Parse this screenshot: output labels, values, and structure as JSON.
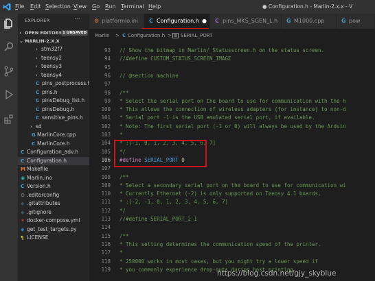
{
  "menubar": {
    "items": [
      {
        "label": "File"
      },
      {
        "label": "Edit"
      },
      {
        "label": "Selection"
      },
      {
        "label": "View"
      },
      {
        "label": "Go"
      },
      {
        "label": "Run"
      },
      {
        "label": "Terminal"
      },
      {
        "label": "Help"
      }
    ],
    "window_title": "● Configuration.h - Marlin-2.x.x - V"
  },
  "activitybar": {
    "icons": [
      "explorer-icon",
      "search-icon",
      "source-control-icon",
      "run-debug-icon",
      "extensions-icon"
    ]
  },
  "sidebar": {
    "title": "EXPLORER",
    "more": "···",
    "open_editors": {
      "label": "OPEN EDITORS",
      "badge": "1 UNSAVED"
    },
    "folder": {
      "label": "MARLIN-2.X.X"
    },
    "tree": [
      {
        "name": "stm32f7",
        "type": "folder"
      },
      {
        "name": "teensy2",
        "type": "folder"
      },
      {
        "name": "teensy3",
        "type": "folder"
      },
      {
        "name": "teensy4",
        "type": "folder"
      },
      {
        "name": "pins_postprocess.h",
        "type": "c"
      },
      {
        "name": "pins.h",
        "type": "c"
      },
      {
        "name": "pinsDebug_list.h",
        "type": "c"
      },
      {
        "name": "pinsDebug.h",
        "type": "c"
      },
      {
        "name": "sensitive_pins.h",
        "type": "c"
      },
      {
        "name": "sd",
        "type": "folder"
      },
      {
        "name": "MarlinCore.cpp",
        "type": "cpp"
      },
      {
        "name": "MarlinCore.h",
        "type": "c"
      },
      {
        "name": "Configuration_adv.h",
        "type": "c"
      },
      {
        "name": "Configuration.h",
        "type": "c"
      },
      {
        "name": "Makefile",
        "type": "make"
      },
      {
        "name": "Marlin.ino",
        "type": "ino"
      },
      {
        "name": "Version.h",
        "type": "c"
      },
      {
        "name": ".editorconfig",
        "type": "gear"
      },
      {
        "name": ".gitattributes",
        "type": "git"
      },
      {
        "name": ".gitignore",
        "type": "git"
      },
      {
        "name": "docker-compose.yml",
        "type": "docker"
      },
      {
        "name": "get_test_targets.py",
        "type": "py"
      },
      {
        "name": "LICENSE",
        "type": "license"
      }
    ]
  },
  "tabs": [
    {
      "label": "platformio.ini",
      "icon": "⚙"
    },
    {
      "label": "Configuration.h",
      "icon": "C"
    },
    {
      "label": "pins_MKS_SGEN_L.h",
      "icon": "C"
    },
    {
      "label": "M1000.cpp",
      "icon": "G"
    },
    {
      "label": "pow",
      "icon": "G"
    }
  ],
  "breadcrumb": {
    "items": [
      "Marlin",
      ">",
      "C",
      "Configuration.h",
      ">",
      "SERIAL_PORT"
    ]
  },
  "editor": {
    "current_line": 106,
    "lines": [
      {
        "n": "93",
        "text": "// Show the bitmap in Marlin/_Statusscreen.h on the status screen."
      },
      {
        "n": "94",
        "text": "//#define CUSTOM_STATUS_SCREEN_IMAGE"
      },
      {
        "n": "95",
        "text": ""
      },
      {
        "n": "96",
        "text": "// @section machine"
      },
      {
        "n": "97",
        "text": ""
      },
      {
        "n": "98",
        "text": "/**"
      },
      {
        "n": "99",
        "text": " * Select the serial port on the board to use for communication with the h"
      },
      {
        "n": "100",
        "text": " * This allows the connection of wireless adapters (for instance) to non-d"
      },
      {
        "n": "101",
        "text": " * Serial port -1 is the USB emulated serial port, if available."
      },
      {
        "n": "102",
        "text": " * Note: The first serial port (-1 or 0) will always be used by the Arduin"
      },
      {
        "n": "103",
        "text": " *"
      },
      {
        "n": "104",
        "text": " * :[-1, 0, 1, 2, 3, 4, 5, 6, 7]"
      },
      {
        "n": "105",
        "text": " */"
      },
      {
        "n": "106",
        "kw": "#define",
        "name": "SERIAL_PORT",
        "val": "0"
      },
      {
        "n": "107",
        "text": ""
      },
      {
        "n": "108",
        "text": "/**"
      },
      {
        "n": "109",
        "text": " * Select a secondary serial port on the board to use for communication wi"
      },
      {
        "n": "110",
        "text": " * Currently Ethernet (-2) is only supported on Teensy 4.1 boards."
      },
      {
        "n": "111",
        "text": " * :[-2, -1, 0, 1, 2, 3, 4, 5, 6, 7]"
      },
      {
        "n": "112",
        "text": " */"
      },
      {
        "n": "113",
        "text": "//#define SERIAL_PORT_2 1"
      },
      {
        "n": "114",
        "text": ""
      },
      {
        "n": "115",
        "text": "/**"
      },
      {
        "n": "116",
        "text": " * This setting determines the communication speed of the printer."
      },
      {
        "n": "117",
        "text": " *"
      },
      {
        "n": "118",
        "text": " * 250000 works in most cases, but you might try a lower speed if"
      },
      {
        "n": "119",
        "text": " * you commonly experience drop-outs during host printing."
      }
    ]
  },
  "watermark": "https://blog.csdn.net/gjy_skyblue",
  "colors": {
    "accent_highlight": "#d0131b",
    "comment": "#6a9955",
    "keyword": "#c586c0",
    "macro": "#569cd6",
    "number": "#b5cea8",
    "editor_bg": "#1e1e1e",
    "sidebar_bg": "#252526"
  }
}
